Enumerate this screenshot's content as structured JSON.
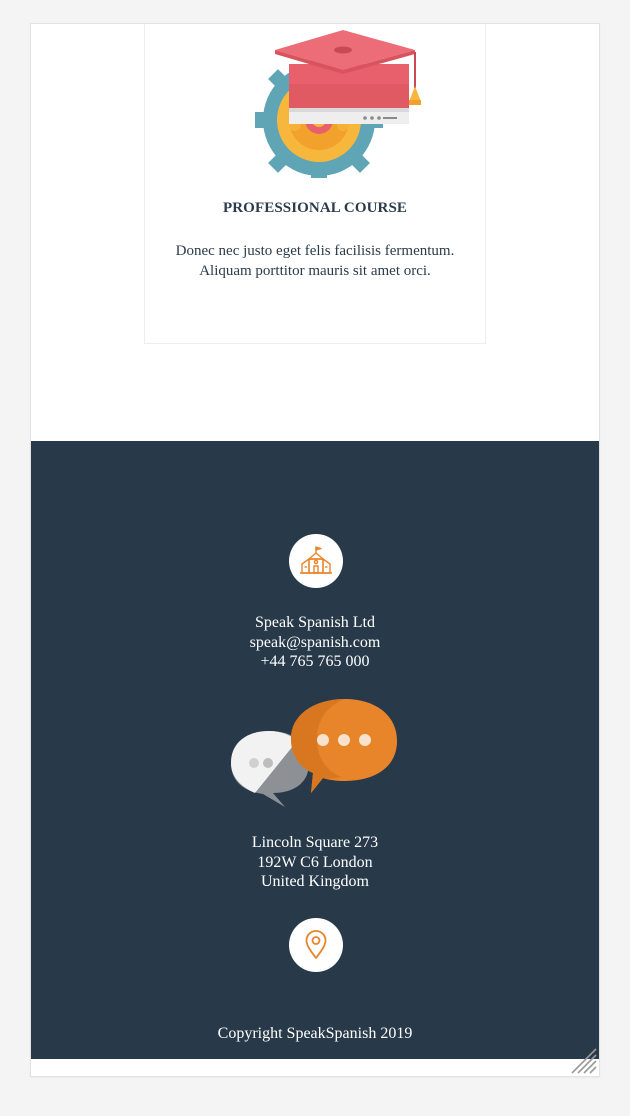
{
  "card": {
    "illustration": "graduation-cap-gear-icon",
    "title": "PROFESSIONAL COURSE",
    "text": "Donec nec justo eget felis facilisis fermentum. Aliquam porttitor mauris sit amet orci."
  },
  "footer": {
    "school_icon": "school-building-icon",
    "contact": {
      "company": "Speak Spanish Ltd",
      "email": "speak@spanish.com",
      "phone": "+44 765 765 000"
    },
    "chat_illustration": "chat-bubbles-icon",
    "address": {
      "line1": "Lincoln Square 273",
      "line2": "192W C6 London",
      "line3": "United Kingdom"
    },
    "pin_icon": "location-pin-icon",
    "copyright": "Copyright SpeakSpanish 2019"
  },
  "colors": {
    "page_background": "#f4f4f4",
    "card_text": "#2b3b4b",
    "footer_background": "#283a4a",
    "accent_orange": "#e8852a",
    "cap_red": "#e8606b",
    "gear_teal": "#5fa5b6"
  }
}
